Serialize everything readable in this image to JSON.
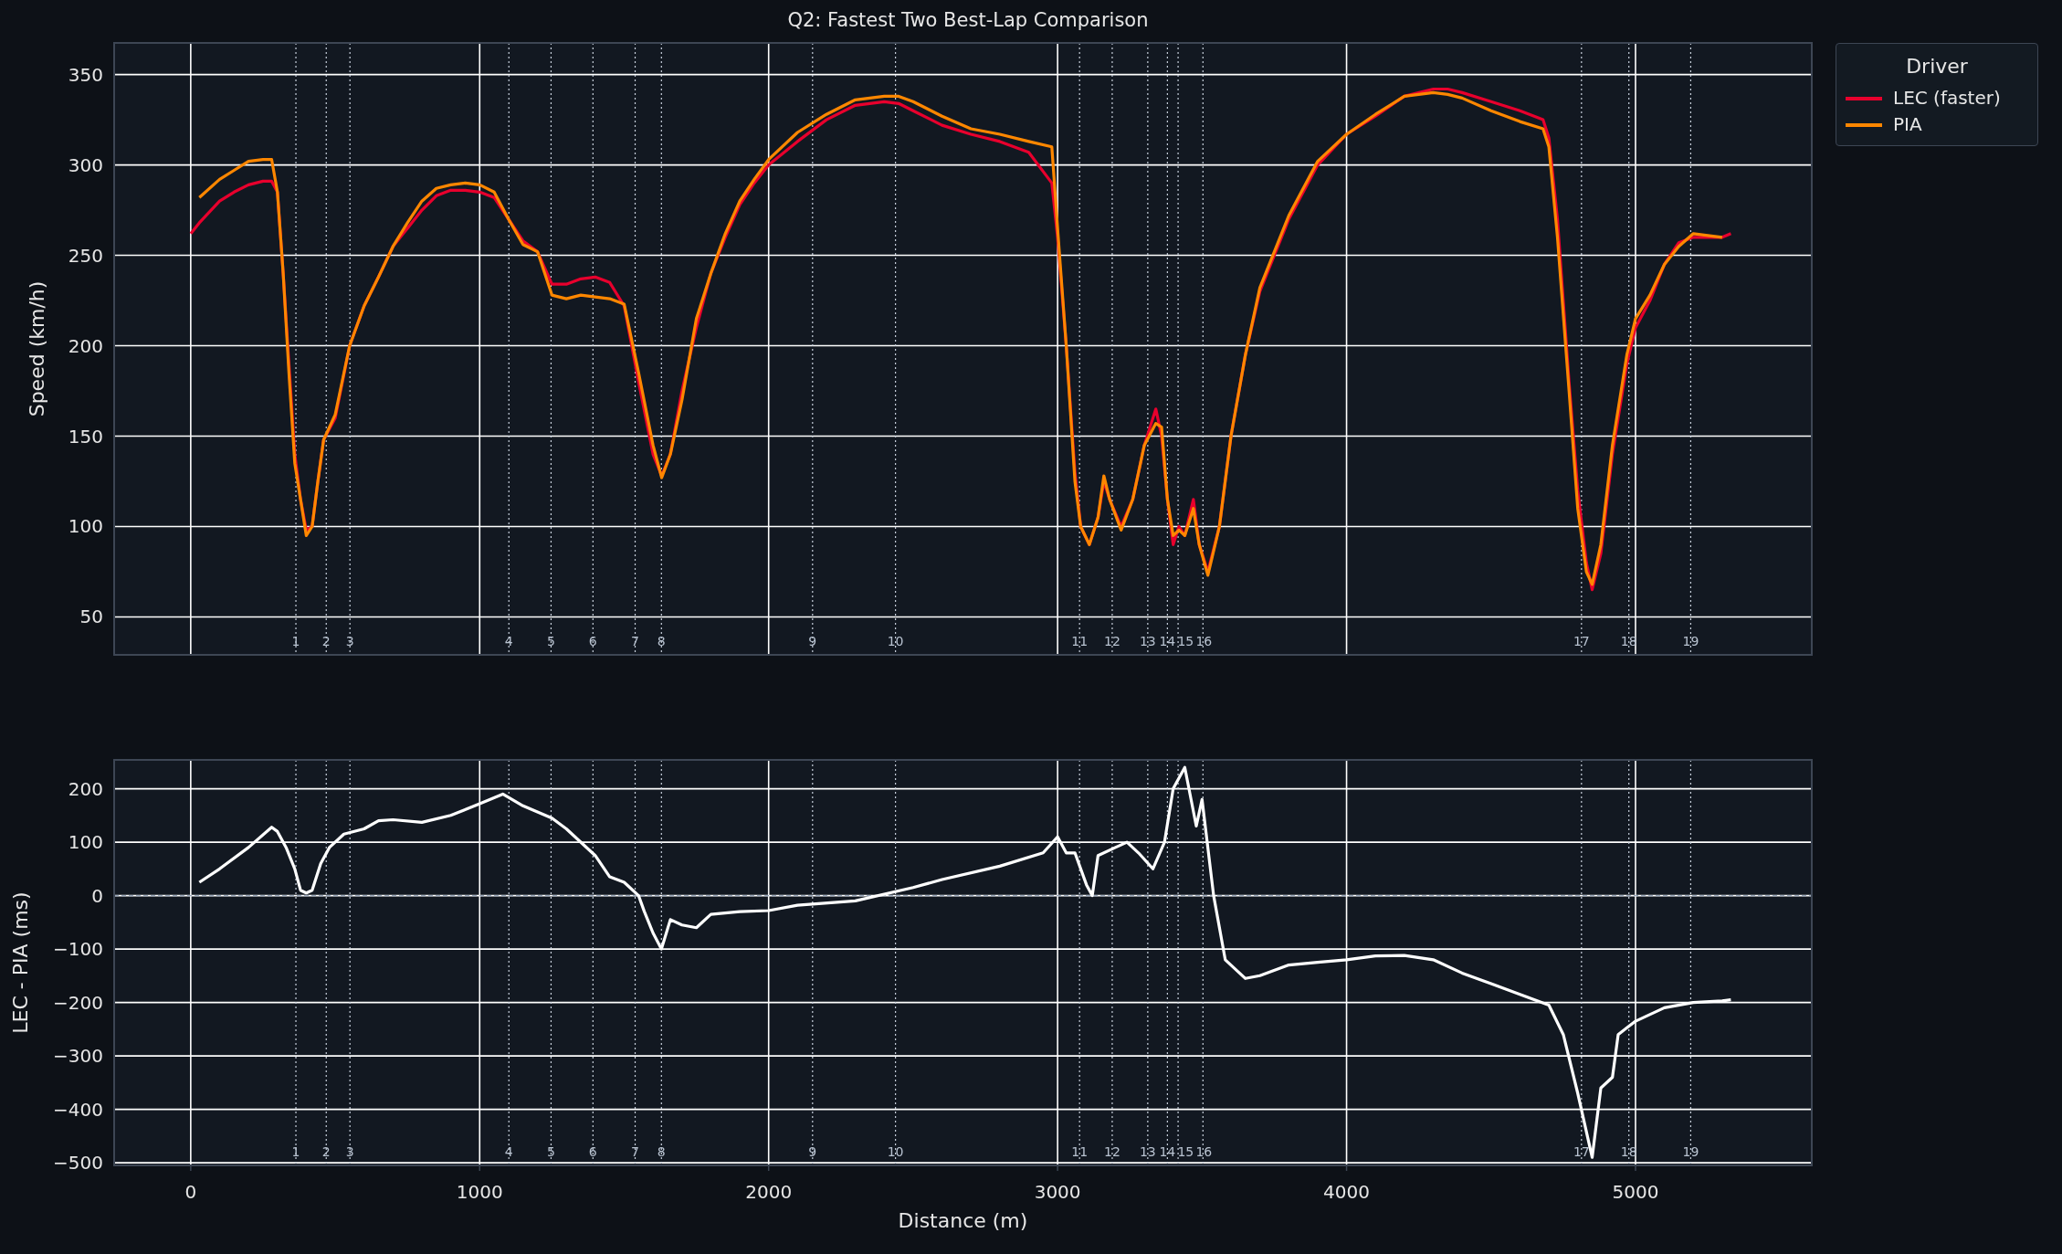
{
  "figure": {
    "title": "Q2: Fastest Two Best-Lap Comparison"
  },
  "speed_panel": {
    "legend_title": "Driver",
    "turn_labels": [
      "1",
      "2",
      "3",
      "4",
      "5",
      "6",
      "7",
      "8",
      "9",
      "10",
      "11",
      "12",
      "13",
      "14",
      "15",
      "16",
      "17",
      "18",
      "19"
    ],
    "chart_data": {
      "type": "line",
      "ylabel": "Speed (km/h)",
      "xlim": [
        -265,
        5610
      ],
      "ylim": [
        29,
        367.5
      ],
      "yticks": [
        50,
        100,
        150,
        200,
        250,
        300,
        350
      ],
      "x": [
        0,
        30,
        100,
        150,
        200,
        250,
        280,
        300,
        320,
        340,
        360,
        380,
        400,
        420,
        440,
        460,
        500,
        550,
        600,
        650,
        700,
        750,
        800,
        850,
        900,
        950,
        1000,
        1050,
        1100,
        1150,
        1200,
        1250,
        1300,
        1350,
        1400,
        1450,
        1500,
        1550,
        1600,
        1630,
        1660,
        1700,
        1750,
        1800,
        1850,
        1900,
        1950,
        2000,
        2100,
        2200,
        2300,
        2400,
        2450,
        2500,
        2600,
        2700,
        2800,
        2900,
        2980,
        3000,
        3030,
        3060,
        3080,
        3110,
        3140,
        3160,
        3180,
        3220,
        3260,
        3300,
        3340,
        3360,
        3380,
        3400,
        3420,
        3440,
        3470,
        3490,
        3520,
        3560,
        3600,
        3650,
        3700,
        3800,
        3900,
        4000,
        4100,
        4200,
        4300,
        4350,
        4400,
        4500,
        4600,
        4680,
        4700,
        4730,
        4770,
        4800,
        4830,
        4850,
        4880,
        4920,
        4970,
        5000,
        5050,
        5100,
        5150,
        5200,
        5300,
        5330
      ],
      "series": [
        {
          "name": "LEC (faster)",
          "color": "#e8002d",
          "values": [
            262,
            268,
            280,
            285,
            289,
            291,
            291,
            285,
            240,
            190,
            140,
            115,
            98,
            100,
            125,
            148,
            160,
            200,
            222,
            238,
            255,
            265,
            275,
            283,
            286,
            286,
            285,
            282,
            270,
            258,
            252,
            234,
            234,
            237,
            238,
            235,
            222,
            180,
            140,
            128,
            140,
            175,
            210,
            240,
            260,
            278,
            290,
            300,
            313,
            325,
            333,
            335,
            334,
            330,
            322,
            317,
            313,
            307,
            290,
            260,
            200,
            130,
            100,
            90,
            105,
            125,
            115,
            100,
            115,
            145,
            165,
            150,
            115,
            90,
            100,
            95,
            115,
            90,
            75,
            100,
            150,
            195,
            230,
            270,
            300,
            317,
            327,
            338,
            342,
            342,
            340,
            335,
            330,
            325,
            315,
            270,
            180,
            120,
            80,
            65,
            85,
            140,
            190,
            210,
            225,
            245,
            257,
            260,
            260,
            262
          ]
        },
        {
          "name": "PIA",
          "color": "#ff8700",
          "values": [
            null,
            282,
            292,
            297,
            302,
            303,
            303,
            285,
            240,
            185,
            135,
            115,
            95,
            100,
            125,
            148,
            162,
            200,
            222,
            238,
            255,
            268,
            280,
            287,
            289,
            290,
            289,
            285,
            270,
            256,
            252,
            228,
            226,
            228,
            227,
            226,
            223,
            185,
            145,
            127,
            140,
            170,
            215,
            240,
            262,
            280,
            292,
            303,
            318,
            328,
            336,
            338,
            338,
            335,
            327,
            320,
            317,
            313,
            310,
            265,
            200,
            125,
            100,
            90,
            105,
            128,
            115,
            98,
            115,
            145,
            157,
            155,
            115,
            95,
            98,
            95,
            110,
            90,
            73,
            100,
            150,
            195,
            232,
            272,
            302,
            317,
            328,
            338,
            340,
            339,
            337,
            330,
            324,
            320,
            310,
            260,
            175,
            110,
            75,
            68,
            90,
            145,
            195,
            215,
            228,
            245,
            255,
            262,
            260,
            null
          ]
        }
      ],
      "grid": true,
      "ref_lines": [
        {
          "axis": "x",
          "value": 364
        },
        {
          "axis": "x",
          "value": 469
        },
        {
          "axis": "x",
          "value": 551
        },
        {
          "axis": "x",
          "value": 1101
        },
        {
          "axis": "x",
          "value": 1247
        },
        {
          "axis": "x",
          "value": 1392
        },
        {
          "axis": "x",
          "value": 1538
        },
        {
          "axis": "x",
          "value": 1629
        },
        {
          "axis": "x",
          "value": 2152
        },
        {
          "axis": "x",
          "value": 2439
        },
        {
          "axis": "x",
          "value": 3076
        },
        {
          "axis": "x",
          "value": 3189
        },
        {
          "axis": "x",
          "value": 3312
        },
        {
          "axis": "x",
          "value": 3380
        },
        {
          "axis": "x",
          "value": 3417
        },
        {
          "axis": "x",
          "value": 3503
        },
        {
          "axis": "x",
          "value": 4813
        },
        {
          "axis": "x",
          "value": 4977
        },
        {
          "axis": "x",
          "value": 5191
        }
      ]
    }
  },
  "delta_panel": {
    "turn_labels": [
      "1",
      "2",
      "3",
      "4",
      "5",
      "6",
      "7",
      "8",
      "9",
      "10",
      "11",
      "12",
      "13",
      "14",
      "15",
      "16",
      "17",
      "18",
      "19"
    ],
    "chart_data": {
      "type": "line",
      "xlabel": "Distance (m)",
      "ylabel": "LEC - PIA (ms)",
      "xlim": [
        -265,
        5610
      ],
      "ylim": [
        -505,
        254
      ],
      "xticks": [
        0,
        1000,
        2000,
        3000,
        4000,
        5000
      ],
      "yticks": [
        {
          "value": -500,
          "label": "−500"
        },
        {
          "value": -400,
          "label": "−400"
        },
        {
          "value": -300,
          "label": "−300"
        },
        {
          "value": -200,
          "label": "−200"
        },
        {
          "value": -100,
          "label": "−100"
        },
        {
          "value": 0,
          "label": "0"
        },
        {
          "value": 100,
          "label": "100"
        },
        {
          "value": 200,
          "label": "200"
        }
      ],
      "x": [
        30,
        100,
        200,
        280,
        300,
        330,
        360,
        380,
        400,
        420,
        450,
        480,
        530,
        600,
        650,
        700,
        800,
        900,
        1000,
        1080,
        1150,
        1250,
        1300,
        1400,
        1450,
        1500,
        1550,
        1570,
        1600,
        1629,
        1660,
        1700,
        1750,
        1800,
        1900,
        2000,
        2100,
        2300,
        2500,
        2600,
        2800,
        2950,
        3000,
        3030,
        3060,
        3100,
        3120,
        3140,
        3200,
        3240,
        3280,
        3330,
        3370,
        3400,
        3440,
        3480,
        3500,
        3540,
        3580,
        3650,
        3700,
        3800,
        3900,
        4000,
        4100,
        4200,
        4300,
        4400,
        4500,
        4600,
        4700,
        4750,
        4800,
        4850,
        4880,
        4920,
        4940,
        5000,
        5100,
        5200,
        5300,
        5330
      ],
      "series": [
        {
          "color": "#ffffff",
          "values": [
            25,
            50,
            90,
            128,
            120,
            90,
            50,
            10,
            5,
            10,
            60,
            90,
            115,
            125,
            140,
            142,
            137,
            150,
            172,
            190,
            168,
            145,
            125,
            75,
            35,
            25,
            0,
            -30,
            -70,
            -100,
            -45,
            -55,
            -60,
            -35,
            -30,
            -28,
            -18,
            -10,
            15,
            30,
            55,
            80,
            110,
            80,
            80,
            20,
            0,
            75,
            90,
            100,
            80,
            50,
            100,
            200,
            240,
            130,
            180,
            0,
            -120,
            -155,
            -150,
            -130,
            -125,
            -120,
            -113,
            -112,
            -120,
            -145,
            -165,
            -185,
            -205,
            -260,
            -370,
            -490,
            -360,
            -340,
            -260,
            -235,
            -210,
            -200,
            -197,
            -195
          ]
        }
      ],
      "grid": true,
      "ref_lines": [
        {
          "axis": "y",
          "value": 0
        },
        {
          "axis": "x",
          "value": 364
        },
        {
          "axis": "x",
          "value": 469
        },
        {
          "axis": "x",
          "value": 551
        },
        {
          "axis": "x",
          "value": 1101
        },
        {
          "axis": "x",
          "value": 1247
        },
        {
          "axis": "x",
          "value": 1392
        },
        {
          "axis": "x",
          "value": 1538
        },
        {
          "axis": "x",
          "value": 1629
        },
        {
          "axis": "x",
          "value": 2152
        },
        {
          "axis": "x",
          "value": 2439
        },
        {
          "axis": "x",
          "value": 3076
        },
        {
          "axis": "x",
          "value": 3189
        },
        {
          "axis": "x",
          "value": 3312
        },
        {
          "axis": "x",
          "value": 3380
        },
        {
          "axis": "x",
          "value": 3417
        },
        {
          "axis": "x",
          "value": 3503
        },
        {
          "axis": "x",
          "value": 4813
        },
        {
          "axis": "x",
          "value": 4977
        },
        {
          "axis": "x",
          "value": 5191
        }
      ]
    }
  }
}
